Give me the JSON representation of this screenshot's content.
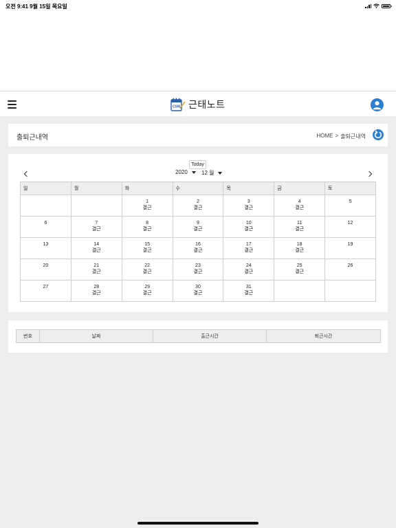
{
  "status_bar": {
    "time": "오전 9:41  9월 15일 목요일"
  },
  "header": {
    "logo_badge": "CSM",
    "app_title": "근태노트",
    "brand_color": "#2a7fd0"
  },
  "page": {
    "title": "출퇴근내역",
    "breadcrumb_home": "HOME",
    "breadcrumb_separator": ">",
    "breadcrumb_current": "출퇴근내역"
  },
  "calendar": {
    "today_label": "Today",
    "year": "2020",
    "month": "12 월",
    "weekdays": [
      "일",
      "월",
      "화",
      "수",
      "목",
      "금",
      "토"
    ],
    "weeks": [
      [
        {
          "day": "",
          "status": ""
        },
        {
          "day": "",
          "status": ""
        },
        {
          "day": "1",
          "status": "결근"
        },
        {
          "day": "2",
          "status": "결근"
        },
        {
          "day": "3",
          "status": "결근"
        },
        {
          "day": "4",
          "status": "결근"
        },
        {
          "day": "5",
          "status": ""
        }
      ],
      [
        {
          "day": "6",
          "status": ""
        },
        {
          "day": "7",
          "status": "결근"
        },
        {
          "day": "8",
          "status": "결근"
        },
        {
          "day": "9",
          "status": "결근"
        },
        {
          "day": "10",
          "status": "결근"
        },
        {
          "day": "11",
          "status": "결근"
        },
        {
          "day": "12",
          "status": ""
        }
      ],
      [
        {
          "day": "13",
          "status": ""
        },
        {
          "day": "14",
          "status": "결근"
        },
        {
          "day": "15",
          "status": "결근"
        },
        {
          "day": "16",
          "status": "결근"
        },
        {
          "day": "17",
          "status": "결근"
        },
        {
          "day": "18",
          "status": "결근"
        },
        {
          "day": "19",
          "status": ""
        }
      ],
      [
        {
          "day": "20",
          "status": ""
        },
        {
          "day": "21",
          "status": "결근"
        },
        {
          "day": "22",
          "status": "결근"
        },
        {
          "day": "23",
          "status": "결근"
        },
        {
          "day": "24",
          "status": "결근"
        },
        {
          "day": "25",
          "status": "결근"
        },
        {
          "day": "26",
          "status": ""
        }
      ],
      [
        {
          "day": "27",
          "status": ""
        },
        {
          "day": "28",
          "status": "결근"
        },
        {
          "day": "29",
          "status": "결근"
        },
        {
          "day": "30",
          "status": "결근"
        },
        {
          "day": "31",
          "status": "결근"
        },
        {
          "day": "",
          "status": ""
        },
        {
          "day": "",
          "status": ""
        }
      ]
    ]
  },
  "history_table": {
    "columns": [
      "번호",
      "날짜",
      "출근시간",
      "퇴근시간"
    ]
  }
}
